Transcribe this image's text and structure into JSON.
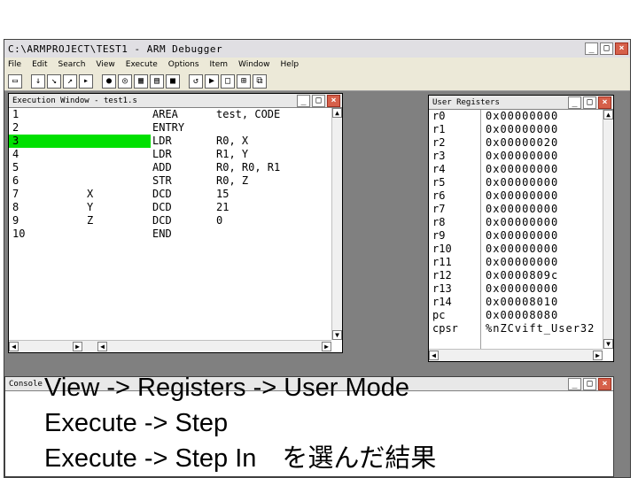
{
  "main_window": {
    "title": "C:\\ARMPROJECT\\TEST1 - ARM Debugger",
    "min": "_",
    "max": "□",
    "close": "×"
  },
  "menu": [
    "File",
    "Edit",
    "Search",
    "View",
    "Execute",
    "Options",
    "Item",
    "Window",
    "Help"
  ],
  "toolbar_icons": [
    "open-icon",
    "step-icon",
    "step-in-icon",
    "step-out-icon",
    "run-icon",
    "breakpoint-icon",
    "watch-icon",
    "memory-icon",
    "register-icon",
    "stop-icon",
    "reset-icon",
    "go-icon",
    "window-icon",
    "tile-icon",
    "cascade-icon"
  ],
  "execution_window": {
    "title": "Execution Window - test1.s",
    "min": "_",
    "max": "□",
    "close": "×",
    "highlighted_line": 3,
    "lines": [
      {
        "num": "1",
        "label": "",
        "op": "AREA",
        "arg": "test, CODE"
      },
      {
        "num": "2",
        "label": "",
        "op": "ENTRY",
        "arg": ""
      },
      {
        "num": "3",
        "label": "",
        "op": "LDR",
        "arg": "R0, X"
      },
      {
        "num": "4",
        "label": "",
        "op": "LDR",
        "arg": "R1, Y"
      },
      {
        "num": "5",
        "label": "",
        "op": "ADD",
        "arg": "R0, R0, R1"
      },
      {
        "num": "6",
        "label": "",
        "op": "STR",
        "arg": "R0, Z"
      },
      {
        "num": "7",
        "label": "X",
        "op": "DCD",
        "arg": "15"
      },
      {
        "num": "8",
        "label": "Y",
        "op": "DCD",
        "arg": "21"
      },
      {
        "num": "9",
        "label": "Z",
        "op": "DCD",
        "arg": "0"
      },
      {
        "num": "10",
        "label": "",
        "op": "END",
        "arg": ""
      }
    ]
  },
  "registers_window": {
    "title": "User Registers",
    "min": "_",
    "max": "□",
    "close": "×",
    "rows": [
      {
        "name": "r0",
        "value": "0x00000000"
      },
      {
        "name": "r1",
        "value": "0x00000000"
      },
      {
        "name": "r2",
        "value": "0x00000020"
      },
      {
        "name": "r3",
        "value": "0x00000000"
      },
      {
        "name": "r4",
        "value": "0x00000000"
      },
      {
        "name": "r5",
        "value": "0x00000000"
      },
      {
        "name": "r6",
        "value": "0x00000000"
      },
      {
        "name": "r7",
        "value": "0x00000000"
      },
      {
        "name": "r8",
        "value": "0x00000000"
      },
      {
        "name": "r9",
        "value": "0x00000000"
      },
      {
        "name": "r10",
        "value": "0x00000000"
      },
      {
        "name": "r11",
        "value": "0x00000000"
      },
      {
        "name": "r12",
        "value": "0x0000809c"
      },
      {
        "name": "r13",
        "value": "0x00000000"
      },
      {
        "name": "r14",
        "value": "0x00008010"
      },
      {
        "name": "pc",
        "value": "0x00008080"
      },
      {
        "name": "cpsr",
        "value": "%nZCvift_User32"
      }
    ]
  },
  "console_window": {
    "title": "Console",
    "min": "_",
    "max": "□",
    "close": "×"
  },
  "caption": {
    "line1": "View -> Registers -> User Mode",
    "line2": "Execute -> Step",
    "line3": "Execute -> Step In　を選んだ結果"
  }
}
